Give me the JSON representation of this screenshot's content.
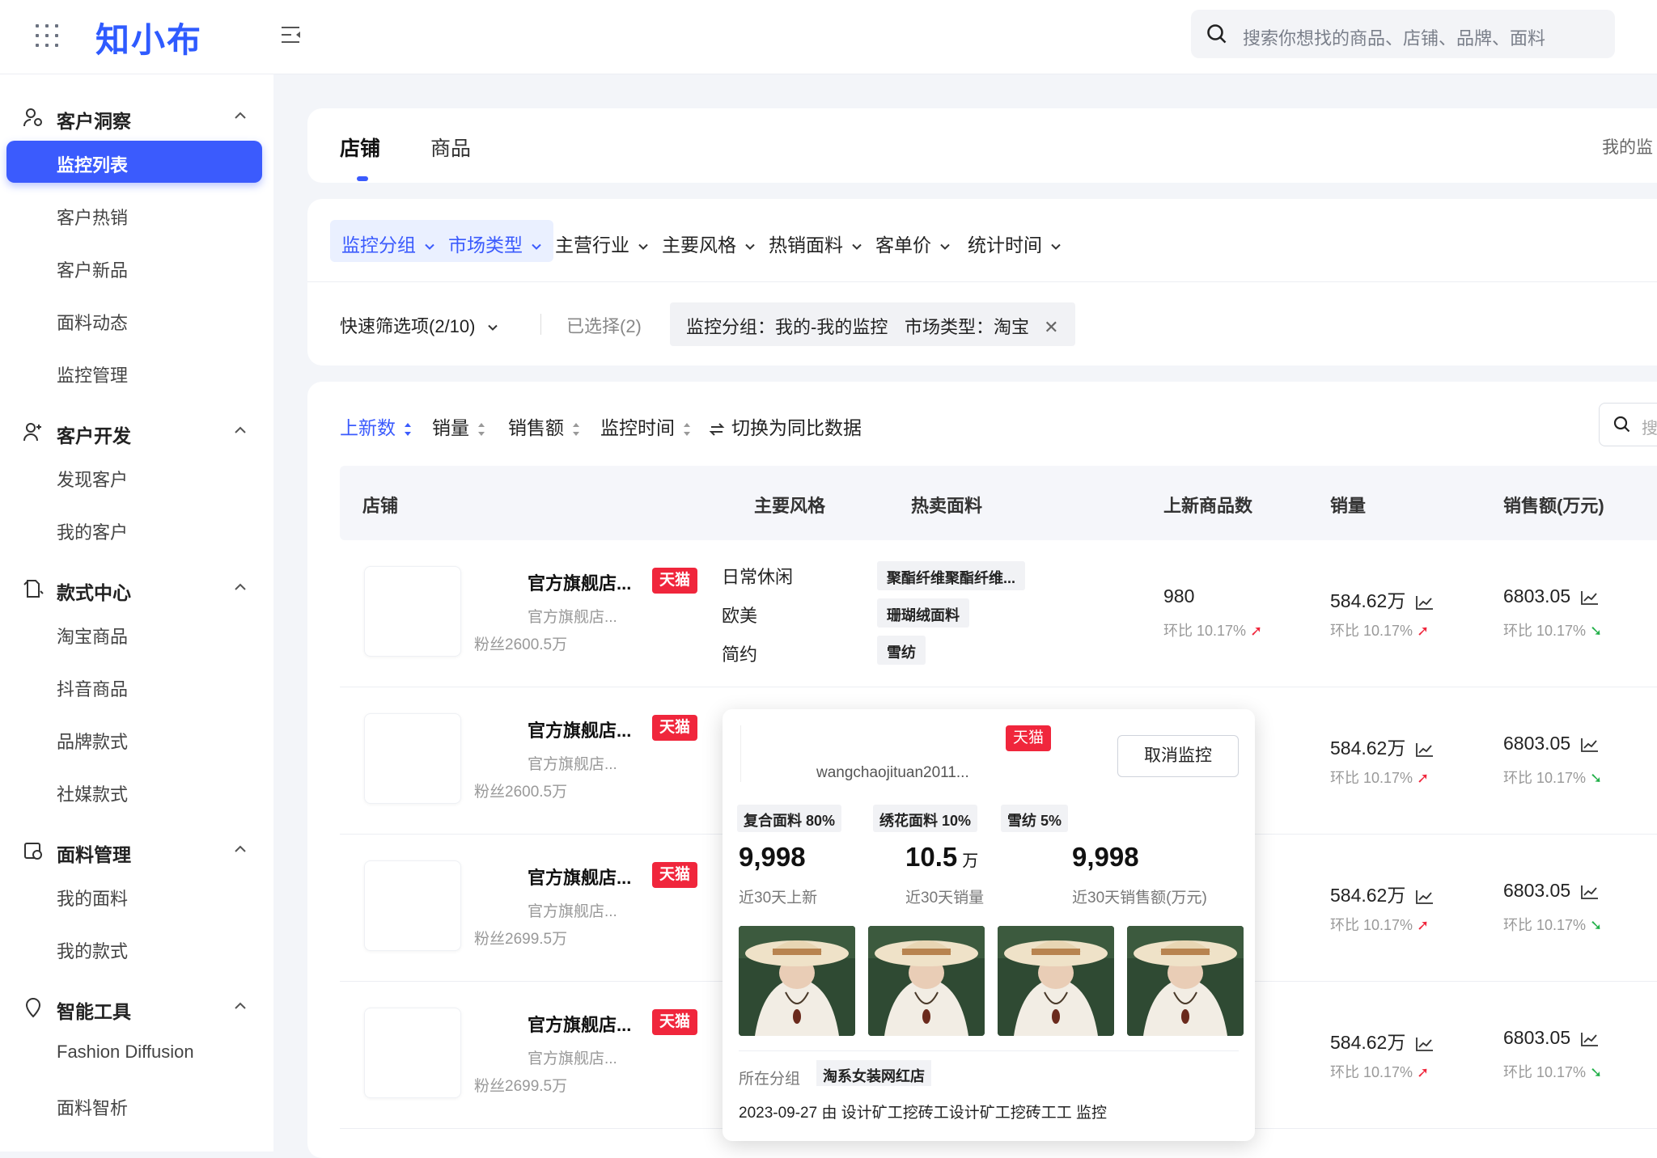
{
  "header": {
    "logo": "知小布",
    "search_placeholder": "搜索你想找的商品、店铺、品牌、面料"
  },
  "sidebar": {
    "groups": [
      {
        "label": "客户洞察",
        "icon": "user-insight-icon",
        "items": [
          "监控列表",
          "客户热销",
          "客户新品",
          "面料动态",
          "监控管理"
        ]
      },
      {
        "label": "客户开发",
        "icon": "user-develop-icon",
        "items": [
          "发现客户",
          "我的客户"
        ]
      },
      {
        "label": "款式中心",
        "icon": "style-center-icon",
        "items": [
          "淘宝商品",
          "抖音商品",
          "品牌款式",
          "社媒款式"
        ]
      },
      {
        "label": "面料管理",
        "icon": "fabric-manage-icon",
        "items": [
          "我的面料",
          "我的款式"
        ]
      },
      {
        "label": "智能工具",
        "icon": "smart-tool-icon",
        "items": [
          "Fashion Diffusion",
          "面料智析"
        ]
      }
    ],
    "active_item": "监控列表"
  },
  "tabs": {
    "items": [
      "店铺",
      "商品"
    ],
    "active": "店铺",
    "right_text": "我的监"
  },
  "filters": {
    "dropdowns": [
      "监控分组",
      "市场类型",
      "主营行业",
      "主要风格",
      "热销面料",
      "客单价",
      "统计时间"
    ],
    "selected_dropdowns": [
      "监控分组",
      "市场类型"
    ],
    "quick_filter": "快速筛选项(2/10)",
    "selected_count": "已选择(2)",
    "tags": [
      "监控分组：我的-我的监控",
      "市场类型：淘宝"
    ]
  },
  "sort_bar": {
    "items": [
      "上新数",
      "销量",
      "销售额",
      "监控时间"
    ],
    "active": "上新数",
    "switch_label": "切换为同比数据",
    "search_hint": "搜"
  },
  "table": {
    "headers": [
      "店铺",
      "主要风格",
      "热卖面料",
      "上新商品数",
      "销量",
      "销售额(万元)"
    ],
    "rows": [
      {
        "shop": "官方旗舰店...",
        "platform": "天猫",
        "sub": "官方旗舰店...",
        "fans": "粉丝2600.5万",
        "styles": [
          "日常休闲",
          "欧美",
          "简约"
        ],
        "fabrics": [
          "聚酯纤维聚酯纤维...",
          "珊瑚绒面料",
          "雪纺"
        ],
        "new_count": "980",
        "new_yoy": "环比 10.17%",
        "sales": "584.62万",
        "sales_yoy": "环比 10.17%",
        "revenue": "6803.05",
        "revenue_yoy": "环比 10.17%"
      },
      {
        "shop": "官方旗舰店...",
        "platform": "天猫",
        "sub": "官方旗舰店...",
        "fans": "粉丝2600.5万",
        "sales": "584.62万",
        "sales_yoy": "环比 10.17%",
        "revenue": "6803.05",
        "revenue_yoy": "环比 10.17%"
      },
      {
        "shop": "官方旗舰店...",
        "platform": "天猫",
        "sub": "官方旗舰店...",
        "fans": "粉丝2699.5万",
        "sales": "584.62万",
        "sales_yoy": "环比 10.17%",
        "revenue": "6803.05",
        "revenue_yoy": "环比 10.17%"
      },
      {
        "shop": "官方旗舰店...",
        "platform": "天猫",
        "sub": "官方旗舰店...",
        "fans": "粉丝2699.5万",
        "sales": "584.62万",
        "sales_yoy": "环比 10.17%",
        "revenue": "6803.05",
        "revenue_yoy": "环比 10.17%"
      }
    ]
  },
  "popup": {
    "platform": "天猫",
    "shop_id": "wangchaojituan2011...",
    "cancel_button": "取消监控",
    "fabrics": [
      "复合面料 80%",
      "绣花面料 10%",
      "雪纺 5%"
    ],
    "stats": [
      {
        "value": "9,998",
        "unit": "",
        "label": "近30天上新"
      },
      {
        "value": "10.5",
        "unit": "万",
        "label": "近30天销量"
      },
      {
        "value": "9,998",
        "unit": "",
        "label": "近30天销售额(万元)"
      }
    ],
    "group_label": "所在分组",
    "group_value": "淘系女装网红店",
    "log": "2023-09-27 由 设计矿工挖砖工设计矿工挖砖工工 监控"
  },
  "colors": {
    "accent": "#3b5bfd",
    "tmall": "#f0263c",
    "up": "#f0263c",
    "down": "#23b04a"
  }
}
